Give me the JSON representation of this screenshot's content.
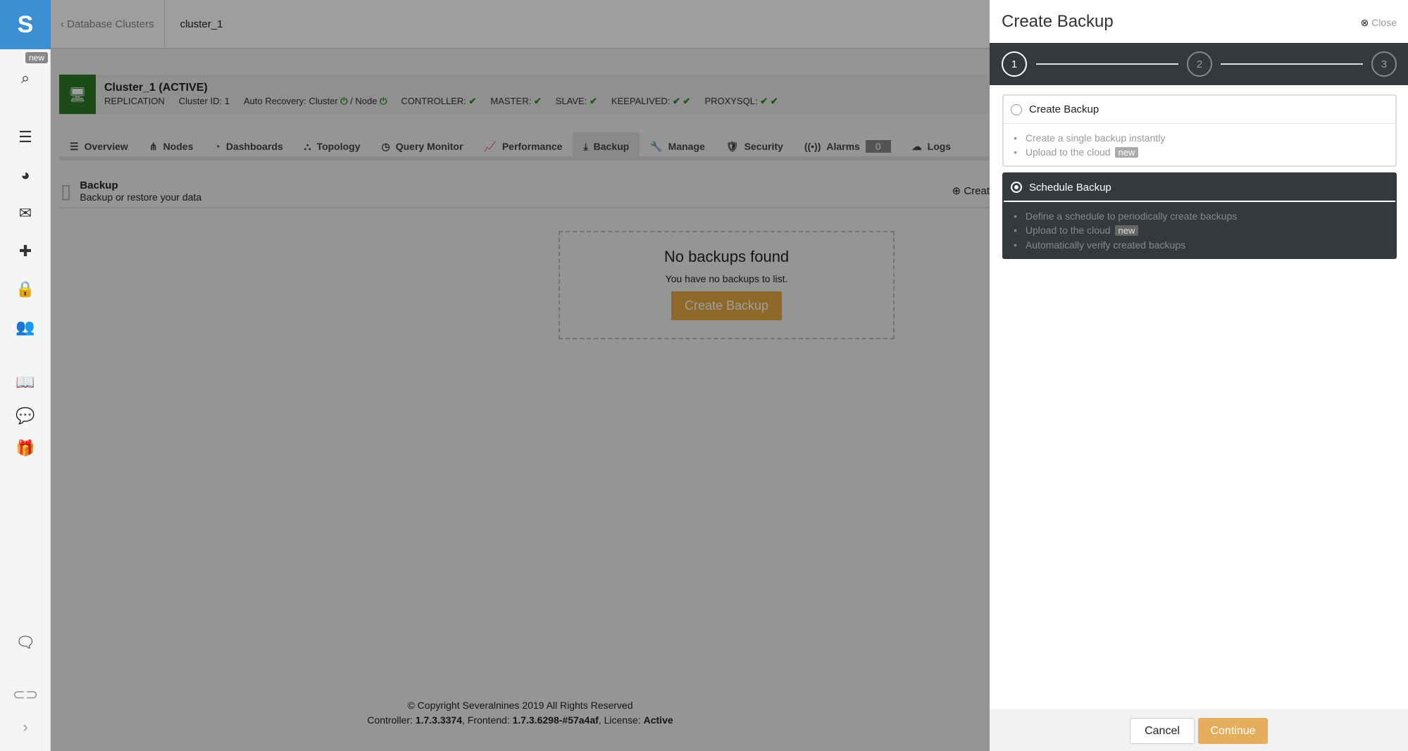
{
  "sidebar": {
    "new_badge": "new"
  },
  "topbar": {
    "back": "Database Clusters",
    "current": "cluster_1"
  },
  "cluster": {
    "name": "Cluster_1 (ACTIVE)",
    "type": "REPLICATION",
    "id": "Cluster ID: 1",
    "recovery": "Auto Recovery: Cluster",
    "recovery_node": "/ Node",
    "controller": "CONTROLLER:",
    "master": "MASTER:",
    "slave": "SLAVE:",
    "keepalived": "KEEPALIVED:",
    "proxysql": "PROXYSQL:"
  },
  "tabs": [
    {
      "label": "Overview",
      "icon": "☰"
    },
    {
      "label": "Nodes",
      "icon": "⋔"
    },
    {
      "label": "Dashboards",
      "icon": "◔"
    },
    {
      "label": "Topology",
      "icon": "⛬"
    },
    {
      "label": "Query Monitor",
      "icon": "◷"
    },
    {
      "label": "Performance",
      "icon": "📈"
    },
    {
      "label": "Backup",
      "icon": "⤓"
    },
    {
      "label": "Manage",
      "icon": "🔧"
    },
    {
      "label": "Security",
      "icon": "🛡"
    },
    {
      "label": "Alarms",
      "icon": "((•))",
      "count": "0"
    },
    {
      "label": "Logs",
      "icon": "☁"
    }
  ],
  "backup_header": {
    "title": "Backup",
    "subtitle": "Backup or restore your data",
    "create": "Creat"
  },
  "empty": {
    "title": "No backups found",
    "text": "You have no backups to list.",
    "button": "Create Backup"
  },
  "footer": {
    "copyright": "© Copyright Severalnines 2019 All Rights Reserved",
    "controller_label": "Controller: ",
    "controller": "1.7.3.3374",
    "frontend_label": ", Frontend: ",
    "frontend": "1.7.3.6298-#57a4af",
    "license_label": ", License: ",
    "license": "Active"
  },
  "panel": {
    "title": "Create Backup",
    "close": "Close",
    "steps": [
      "1",
      "2",
      "3"
    ],
    "options": [
      {
        "label": "Create Backup",
        "items": [
          "Create a single backup instantly",
          "Upload to the cloud"
        ],
        "new": "new",
        "selected": false
      },
      {
        "label": "Schedule Backup",
        "items": [
          "Define a schedule to periodically create backups",
          "Upload to the cloud",
          "Automatically verify created backups"
        ],
        "new": "new",
        "selected": true
      }
    ],
    "cancel": "Cancel",
    "continue": "Continue"
  },
  "colors": {
    "accent": "#e6ad5c",
    "active_green": "#2d7a24",
    "dark": "#33393c",
    "logo_blue": "#3b8fd3"
  }
}
